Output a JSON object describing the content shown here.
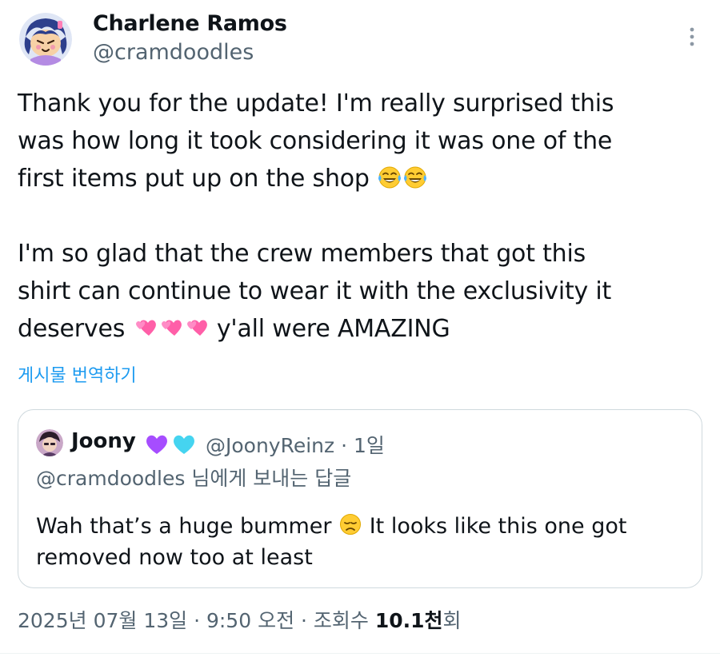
{
  "tweet": {
    "author_name": "Charlene Ramos",
    "author_handle": "@cramdoodles",
    "body_lines_1": [
      "Thank you for the update! I'm really surprised this",
      "was how long it took considering it was one of the",
      "first items put up on the shop"
    ],
    "body_lines_2": [
      "I'm so glad that the crew members that got this",
      "shirt can continue to wear it with the exclusivity it",
      "deserves",
      "y'all were AMAZING"
    ],
    "translate_label": "게시물 번역하기",
    "timestamp": "2025년 07월 13일 · 9:50 오전 · 조회수 ",
    "views_count": "10.1천",
    "views_suffix": "회"
  },
  "quote": {
    "author_name": "Joony",
    "author_handle": "@JoonyReinz · 1일",
    "reply_to": "@cramdoodles 님에게 보내는 답글",
    "text_line_1_a": "Wah that’s a huge bummer",
    "text_line_1_b": "It looks like this one got",
    "text_line_2": "removed now too at least"
  },
  "icons": {
    "more": "more-vertical-icon",
    "laughing": "tears-of-joy-emoji",
    "hearts": "two-hearts-emoji",
    "purple_heart": "purple-heart-emoji",
    "cyan_heart": "light-blue-heart-emoji",
    "disappointed": "disappointed-face-emoji"
  },
  "colors": {
    "link": "#1d9bf0",
    "secondary_text": "#536471",
    "primary_text": "#0f1419",
    "border": "#cfd9de"
  }
}
